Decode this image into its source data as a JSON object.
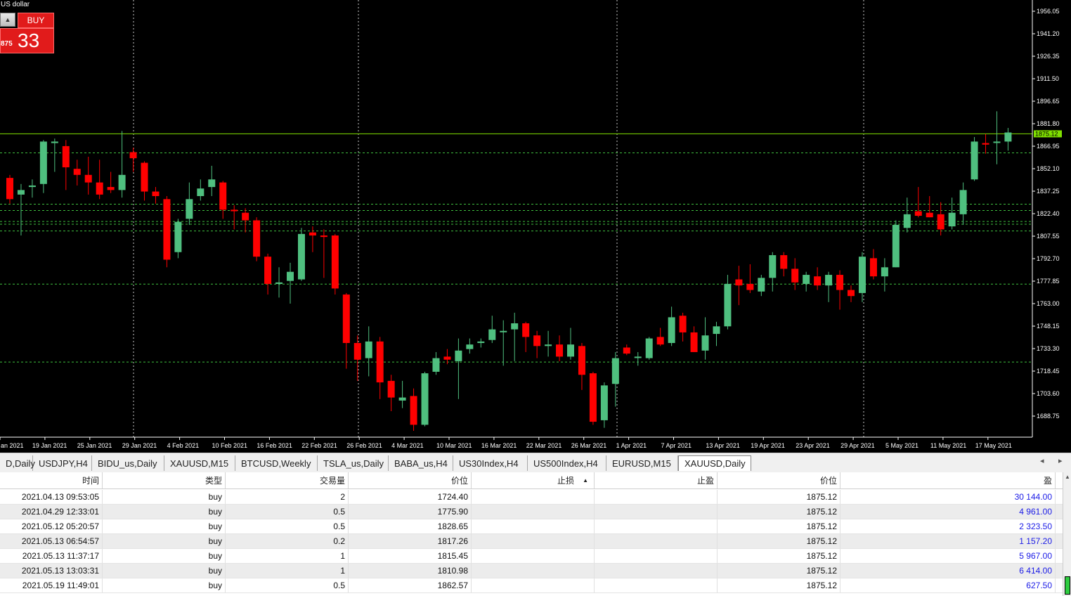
{
  "chart": {
    "symbol_title": "US dollar",
    "current_price_label": "1875.12",
    "price_labels": [
      "1956.05",
      "1941.20",
      "1926.35",
      "1911.50",
      "1896.65",
      "1881.80",
      "1866.95",
      "1852.10",
      "1837.25",
      "1822.40",
      "1807.55",
      "1792.70",
      "1777.85",
      "1763.00",
      "1748.15",
      "1733.30",
      "1718.45",
      "1703.60",
      "1688.75"
    ],
    "date_labels": [
      "an 2021",
      "19 Jan 2021",
      "25 Jan 2021",
      "29 Jan 2021",
      "4 Feb 2021",
      "10 Feb 2021",
      "16 Feb 2021",
      "22 Feb 2021",
      "26 Feb 2021",
      "4 Mar 2021",
      "10 Mar 2021",
      "16 Mar 2021",
      "22 Mar 2021",
      "26 Mar 2021",
      "1 Apr 2021",
      "7 Apr 2021",
      "13 Apr 2021",
      "19 Apr 2021",
      "23 Apr 2021",
      "29 Apr 2021",
      "5 May 2021",
      "11 May 2021",
      "17 May 2021"
    ],
    "colors": {
      "bull": "#4fbf7f",
      "bear": "#ff0000",
      "bid_line": "#7fe000",
      "level_line": "#3fbf3f",
      "grid": "#c8c8c8",
      "background": "#000000"
    }
  },
  "trade_panel": {
    "sell_arrow": "▲",
    "buy_label": "BUY",
    "price_small": "875",
    "price_big": "33"
  },
  "tabs": [
    {
      "label": "D,Daily"
    },
    {
      "label": "USDJPY,H4"
    },
    {
      "label": "BIDU_us,Daily"
    },
    {
      "label": "XAUUSD,M15"
    },
    {
      "label": "BTCUSD,Weekly"
    },
    {
      "label": "TSLA_us,Daily"
    },
    {
      "label": "BABA_us,H4"
    },
    {
      "label": "US30Index,H4"
    },
    {
      "label": "US500Index,H4"
    },
    {
      "label": "EURUSD,M15"
    },
    {
      "label": "XAUUSD,Daily",
      "active": true
    }
  ],
  "tab_scroll": {
    "left": "◂",
    "right": "▸"
  },
  "table": {
    "headers": {
      "time": "时间",
      "type": "类型",
      "volume": "交易量",
      "price": "价位",
      "sl": "止损",
      "sl_sort": "▲",
      "tp": "止盈",
      "current_price": "价位",
      "profit": "盈"
    },
    "rows": [
      {
        "time": "2021.04.13 09:53:05",
        "type": "buy",
        "volume": "2",
        "price": "1724.40",
        "sl": "",
        "tp": "",
        "current_price": "1875.12",
        "profit": "30 144.00"
      },
      {
        "time": "2021.04.29 12:33:01",
        "type": "buy",
        "volume": "0.5",
        "price": "1775.90",
        "sl": "",
        "tp": "",
        "current_price": "1875.12",
        "profit": "4 961.00"
      },
      {
        "time": "2021.05.12 05:20:57",
        "type": "buy",
        "volume": "0.5",
        "price": "1828.65",
        "sl": "",
        "tp": "",
        "current_price": "1875.12",
        "profit": "2 323.50"
      },
      {
        "time": "2021.05.13 06:54:57",
        "type": "buy",
        "volume": "0.2",
        "price": "1817.26",
        "sl": "",
        "tp": "",
        "current_price": "1875.12",
        "profit": "1 157.20"
      },
      {
        "time": "2021.05.13 11:37:17",
        "type": "buy",
        "volume": "1",
        "price": "1815.45",
        "sl": "",
        "tp": "",
        "current_price": "1875.12",
        "profit": "5 967.00"
      },
      {
        "time": "2021.05.13 13:03:31",
        "type": "buy",
        "volume": "1",
        "price": "1810.98",
        "sl": "",
        "tp": "",
        "current_price": "1875.12",
        "profit": "6 414.00"
      },
      {
        "time": "2021.05.19 11:49:01",
        "type": "buy",
        "volume": "0.5",
        "price": "1862.57",
        "sl": "",
        "tp": "",
        "current_price": "1875.12",
        "profit": "627.50"
      }
    ]
  }
}
